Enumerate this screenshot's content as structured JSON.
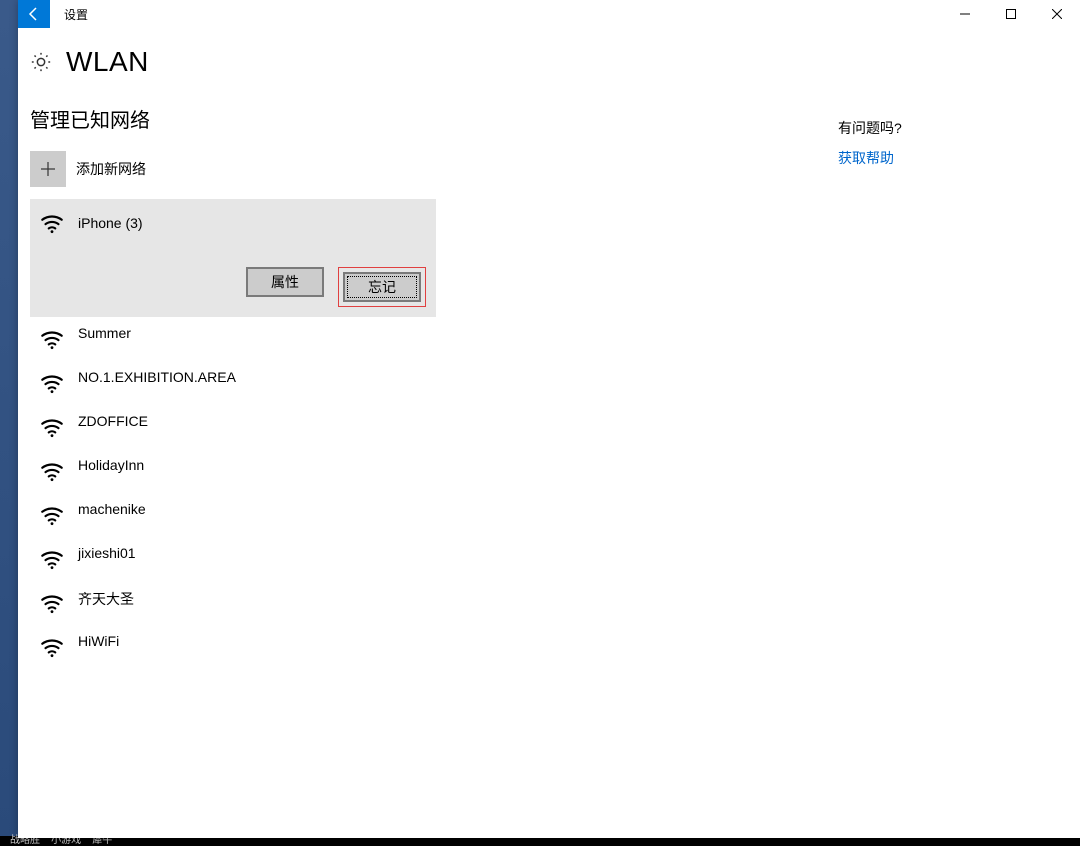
{
  "window": {
    "title": "设置"
  },
  "page": {
    "title": "WLAN",
    "subheader": "管理已知网络",
    "add_network_label": "添加新网络"
  },
  "networks": [
    {
      "name": "iPhone (3)",
      "selected": true
    },
    {
      "name": "Summer",
      "selected": false
    },
    {
      "name": "NO.1.EXHIBITION.AREA",
      "selected": false
    },
    {
      "name": "ZDOFFICE",
      "selected": false
    },
    {
      "name": "HolidayInn",
      "selected": false
    },
    {
      "name": "machenike",
      "selected": false
    },
    {
      "name": "jixieshi01",
      "selected": false
    },
    {
      "name": "齐天大圣",
      "selected": false
    },
    {
      "name": "HiWiFi",
      "selected": false
    }
  ],
  "selected_actions": {
    "properties": "属性",
    "forget": "忘记"
  },
  "sidebar": {
    "help_header": "有问题吗?",
    "help_link": "获取帮助"
  },
  "taskbar": {
    "items": [
      "战略胜",
      "小游戏",
      "犀牛"
    ]
  },
  "annotation": {
    "forget_highlighted": true
  },
  "colors": {
    "accent": "#0078d7",
    "link": "#0066cc",
    "selected_bg": "#e6e6e6",
    "button_bg": "#cccccc",
    "highlight": "#e04040"
  }
}
